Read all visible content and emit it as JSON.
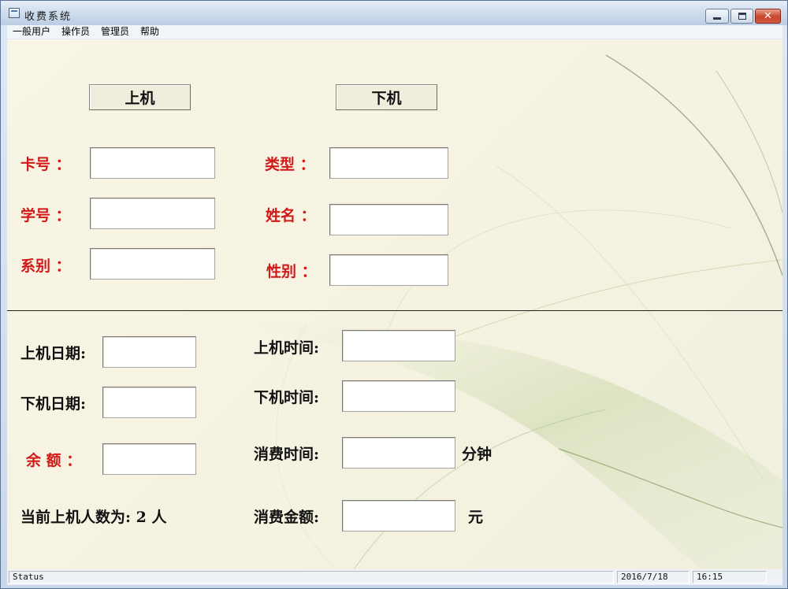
{
  "window": {
    "title": "收费系统"
  },
  "menu": [
    "一般用户",
    "操作员",
    "管理员",
    "帮助"
  ],
  "actions": {
    "login": "上机",
    "logout": "下机"
  },
  "card": {
    "card_no_label": "卡号 ：",
    "type_label": "类型 ：",
    "student_no_label": "学号 ：",
    "name_label": "姓名 ：",
    "department_label": "系别 ：",
    "gender_label": "性别 ：",
    "card_no": "",
    "type": "",
    "student_no": "",
    "name": "",
    "department": "",
    "gender": ""
  },
  "session": {
    "login_date_label": "上机日期:",
    "login_time_label": "上机时间:",
    "logout_date_label": "下机日期:",
    "logout_time_label": "下机时间:",
    "balance_label": "余 额 ：",
    "consume_time_label": "消费时间:",
    "consume_time_unit": "分钟",
    "online_count_label": "当前上机人数为: 2 人",
    "consume_amount_label": "消费金额:",
    "consume_amount_unit": "元",
    "login_date": "",
    "login_time": "",
    "logout_date": "",
    "logout_time": "",
    "balance": "",
    "consume_time": "",
    "consume_amount": ""
  },
  "statusbar": {
    "status": "Status",
    "date": "2016/7/18",
    "time": "16:15"
  }
}
